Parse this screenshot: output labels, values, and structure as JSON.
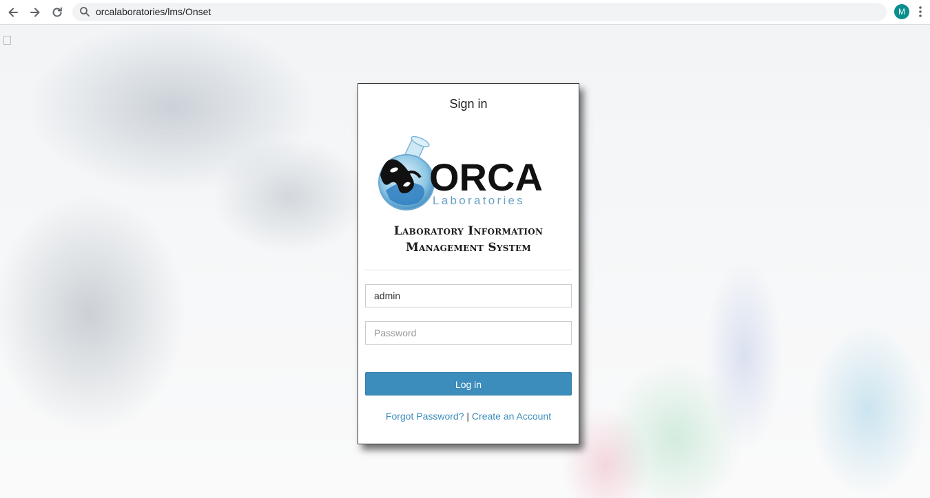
{
  "browser": {
    "url": "orcalaboratories/lms/Onset",
    "profile_initial": "M"
  },
  "login": {
    "title": "Sign in",
    "logo": {
      "brand": "ORCA",
      "subbrand": "Laboratories",
      "brand_color": "#111111",
      "subbrand_color": "#6aa2c4"
    },
    "system_title_line1": "Laboratory Information",
    "system_title_line2": "Management System",
    "username_value": "admin",
    "password_placeholder": "Password",
    "login_button": "Log in",
    "forgot_password": "Forgot Password?",
    "separator": "|",
    "create_account": "Create an Account",
    "accent_color": "#3c8dbc"
  }
}
